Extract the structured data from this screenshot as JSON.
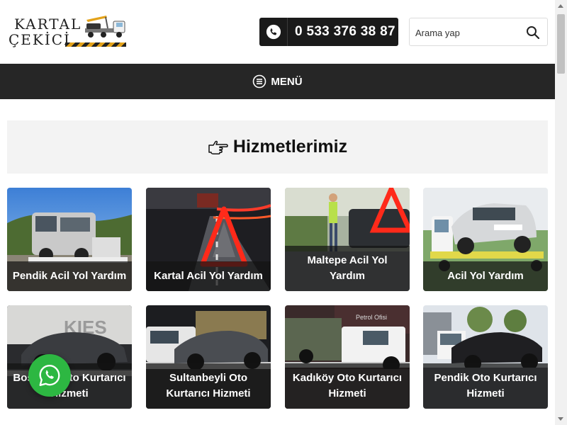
{
  "header": {
    "logo_line1": "KARTAL",
    "logo_line2": "ÇEKİCİ",
    "phone_number": "0 533 376 38 87",
    "search_placeholder": "Arama yap"
  },
  "nav": {
    "menu_label": "MENÜ"
  },
  "services": {
    "title": "Hizmetlerimiz",
    "items": [
      {
        "label": "Pendik Acil Yol Yardım"
      },
      {
        "label": "Kartal Acil Yol Yardım"
      },
      {
        "label": "Maltepe Acil Yol Yardım"
      },
      {
        "label": "Acil Yol Yardım"
      },
      {
        "label": "Bostancı Oto Kurtarıcı Hizmeti"
      },
      {
        "label": "Sultanbeyli Oto Kurtarıcı Hizmeti"
      },
      {
        "label": "Kadıköy Oto Kurtarıcı Hizmeti"
      },
      {
        "label": "Pendik Oto Kurtarıcı Hizmeti"
      }
    ]
  },
  "colors": {
    "nav_bg": "#262626",
    "phone_bg": "#1a1a1a",
    "whatsapp": "#2db742",
    "logo_accent": "#e3a21a"
  }
}
